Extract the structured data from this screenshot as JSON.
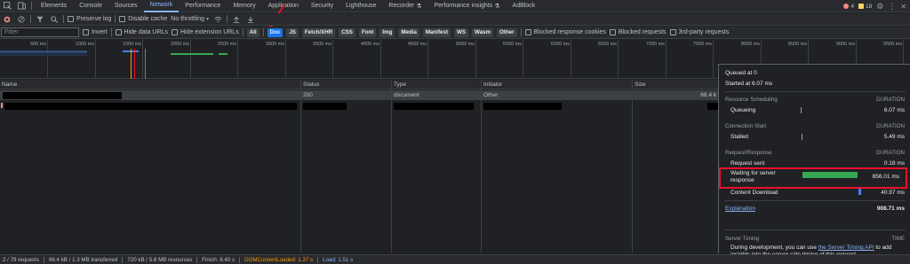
{
  "tabs": [
    "Elements",
    "Console",
    "Sources",
    "Network",
    "Performance",
    "Memory",
    "Application",
    "Security",
    "Lighthouse",
    "Recorder",
    "Performance insights",
    "AdBlock"
  ],
  "active_tab": "Network",
  "badges": {
    "errors": "4",
    "warnings": "18"
  },
  "toolbar": {
    "preserve_log": "Preserve log",
    "disable_cache": "Disable cache",
    "throttling": "No throttling"
  },
  "filter": {
    "placeholder": "Filter",
    "invert": "Invert",
    "hide_data_urls": "Hide data URLs",
    "hide_extension_urls": "Hide extension URLs",
    "types": [
      "All",
      "Doc",
      "JS",
      "Fetch/XHR",
      "CSS",
      "Font",
      "Img",
      "Media",
      "Manifest",
      "WS",
      "Wasm",
      "Other"
    ],
    "selected_type": "Doc",
    "blocked_cookies": "Blocked response cookies",
    "blocked_requests": "Blocked requests",
    "third_party": "3rd-party requests"
  },
  "overview": {
    "ticks": [
      "500 ms",
      "1000 ms",
      "1500 ms",
      "2000 ms",
      "2500 ms",
      "3000 ms",
      "3500 ms",
      "4000 ms",
      "4500 ms",
      "5000 ms",
      "5500 ms",
      "6000 ms",
      "6500 ms",
      "7000 ms",
      "7500 ms",
      "8000 ms",
      "8500 ms",
      "9000 ms",
      "9500 ms"
    ]
  },
  "table": {
    "headers": {
      "name": "Name",
      "status": "Status",
      "type": "Type",
      "initiator": "Initiator",
      "size": "Size"
    },
    "rows": [
      {
        "status": "200",
        "type": "document",
        "initiator": "Other",
        "size": "66.4 k"
      }
    ]
  },
  "timing": {
    "queued": "Queued at 0",
    "started": "Started at 6.07 ms",
    "duration_label": "DURATION",
    "resource_scheduling": "Resource Scheduling",
    "queueing": {
      "label": "Queueing",
      "value": "6.07 ms"
    },
    "connection_start": "Connection Start",
    "stalled": {
      "label": "Stalled",
      "value": "5.49 ms"
    },
    "request_response": "Request/Response",
    "request_sent": {
      "label": "Request sent",
      "value": "0.18 ms"
    },
    "waiting_line1": "Waiting for server",
    "waiting_line2": "response",
    "waiting_value": "856.01 ms",
    "content_download": {
      "label": "Content Download",
      "value": "40.97 ms"
    },
    "explanation": "Explanation",
    "total": "908.71 ms",
    "server_timing": "Server Timing",
    "time_label": "TIME",
    "server_text_1": "During development, you can use",
    "server_link": "the Server Timing API",
    "server_text_2": "to add",
    "server_text_3": "insights into the server-side timing of this request."
  },
  "statusbar": {
    "requests": "2 / 79 requests",
    "transferred": "66.4 kB / 1.3 MB transferred",
    "resources": "720 kB / 5.8 MB resources",
    "finish": "Finish: 8.40 s",
    "dom": "DOMContentLoaded: 1.37 s",
    "load": "Load: 1.51 s"
  },
  "colors": {
    "accent": "#8ab4f8",
    "highlight": "#e8112d",
    "waiting_bar": "#34a853",
    "download_bar": "#4285f4"
  }
}
